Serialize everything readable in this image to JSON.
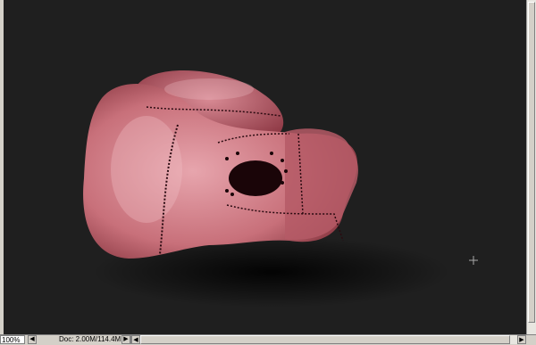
{
  "canvas": {
    "image_subject": "stitched-glove-illustration",
    "background_color": "#1f1f1f",
    "cursor": "+"
  },
  "status_bar": {
    "zoom": "100%",
    "doc_info": "Doc: 2.00M/114.4M",
    "nav_prev_icon": "◀",
    "nav_next_icon": "▶",
    "scroll_left_icon": "◀",
    "scroll_right_icon": "▶"
  },
  "colors": {
    "glove_base": "#c8707a",
    "glove_dark": "#7a2a34",
    "stitch": "#2a0a10",
    "chrome": "#d4d0c8"
  }
}
